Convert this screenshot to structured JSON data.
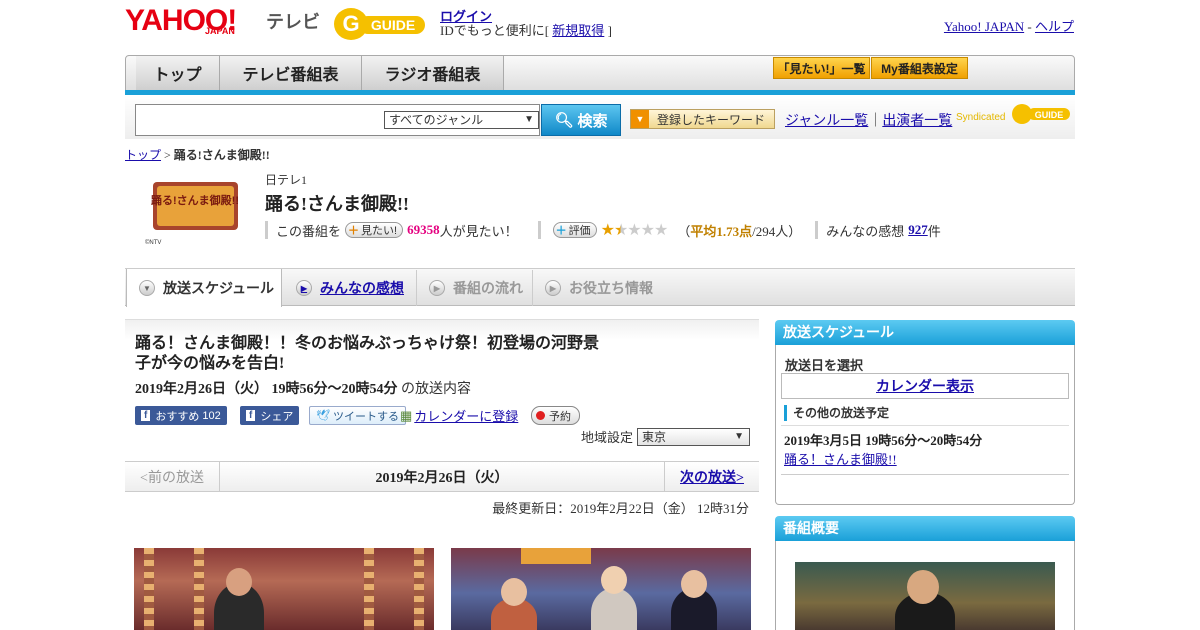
{
  "header": {
    "yahoo": "YAHOO!",
    "japan": "JAPAN",
    "tv": "テレビ",
    "gguide": "GUIDE",
    "login": "ログイン",
    "login_note_prefix": "IDでもっと便利に[ ",
    "register": "新規取得",
    "login_note_suffix": " ]",
    "yahoo_japan_link": "Yahoo! JAPAN",
    "sep": " - ",
    "help_link": "ヘルプ"
  },
  "nav": {
    "tabs": [
      "トップ",
      "テレビ番組表",
      "ラジオ番組表"
    ],
    "want_list": "「見たい!」一覧",
    "my_schedule": "My番組表設定"
  },
  "search": {
    "genre": "すべてのジャンル",
    "button": "検索",
    "keyword_button": "登録したキーワード",
    "genre_list": "ジャンル一覧",
    "cast_list": "出演者一覧",
    "pipe": "｜",
    "syndicated": "Syndicated"
  },
  "breadcrumb": {
    "top": "トップ",
    "sep": " > ",
    "current": "踊る!さんま御殿!!"
  },
  "program": {
    "channel": "日テレ1",
    "title": "踊る!さんま御殿!!",
    "thumb_copyright": "©NTV",
    "thumb_text": "踊る!さんま御殿!!",
    "want_prefix": "この番組を",
    "want_button": "見たい!",
    "want_count": "69358",
    "want_suffix": "人が見たい！",
    "rate_button": "評価",
    "rating": 1.73,
    "avg_open": "（",
    "avg_label": "平均1.73点",
    "avg_count": "/294人）",
    "impressions_label": "みんなの感想",
    "impressions_count": "927",
    "impressions_suffix": "件"
  },
  "subtabs": [
    "放送スケジュール",
    "みんなの感想",
    "番組の流れ",
    "お役立ち情報"
  ],
  "episode": {
    "title": "踊る！さんま御殿！！冬のお悩みぶっちゃけ祭！初登場の河野景子が今の悩みを告白!",
    "datetime": "2019年2月26日（火） 19時56分～20時54分",
    "datetime_suffix": " の放送内容",
    "fb_label": "おすすめ",
    "fb_count": "102",
    "fb_share": "シェア",
    "tweet": "ツイートする",
    "calendar": "カレンダーに登録",
    "reserve": "予約",
    "region_label": "地域設定",
    "region": "東京",
    "prev": "<前の放送",
    "current_date": "2019年2月26日（火）",
    "next": "次の放送>",
    "updated": "最終更新日：2019年2月22日（金） 12時31分"
  },
  "sidebar": {
    "schedule_header": "放送スケジュール",
    "select_date": "放送日を選択",
    "calendar_button": "カレンダー表示",
    "other_header": "その他の放送予定",
    "other_time": "2019年3月5日 19時56分～20時54分",
    "other_link": "踊る！さんま御殿!!",
    "overview_header": "番組概要"
  },
  "colors": {
    "accent_blue": "#1aa0d8",
    "yahoo_red": "#e60012",
    "pink": "#e4007f",
    "star": "#e8a000"
  }
}
